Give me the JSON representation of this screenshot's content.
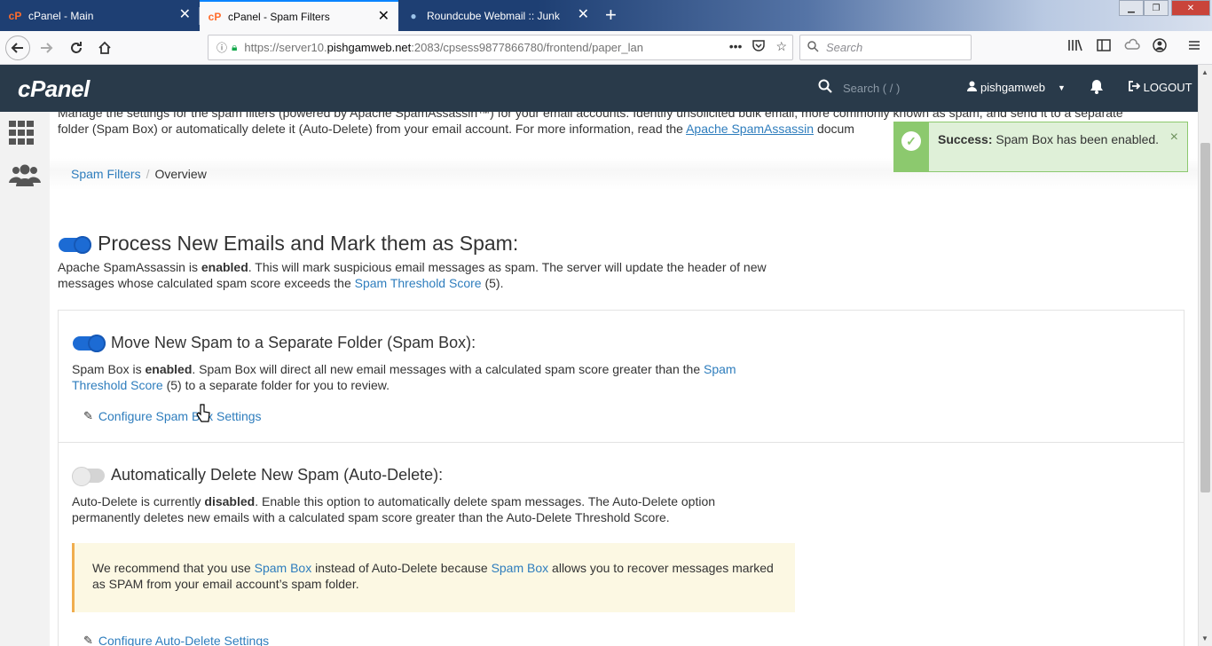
{
  "browser": {
    "tabs": [
      {
        "title": "cPanel - Main",
        "icon": "cpanel-icon"
      },
      {
        "title": "cPanel - Spam Filters",
        "icon": "cpanel-icon"
      },
      {
        "title": "Roundcube Webmail :: Junk",
        "icon": "roundcube-icon"
      }
    ],
    "new_tab": "+",
    "url_prefix": "https://server10.",
    "url_host": "pishgamweb.net",
    "url_rest": ":2083/cpsess9877866780/frontend/paper_lan",
    "search_placeholder": "Search"
  },
  "header": {
    "logo": "cPanel",
    "search_placeholder": "Search ( / )",
    "username": "pishgamweb",
    "logout": "LOGOUT",
    "colors": {
      "header_bg": "#293a4a",
      "accent": "#1c6bd4"
    }
  },
  "intro": {
    "line1": "Manage the settings for the spam filters (powered by Apache SpamAssassin™) for your email accounts. Identify unsolicited bulk email, more commonly known as spam, and send it to a separate",
    "line2_prefix": "folder (Spam Box) or automatically delete it (Auto-Delete) from your email account. For more information, read the ",
    "line2_link": "Apache SpamAssassin",
    "line2_suffix": " docum"
  },
  "breadcrumb": {
    "parent": "Spam Filters",
    "separator": "/",
    "current": "Overview"
  },
  "process": {
    "title": "Process New Emails and Mark them as Spam:",
    "enabled": true,
    "text_a": "Apache SpamAssassin is ",
    "text_bold": "enabled",
    "text_b": ". This will mark suspicious email messages as spam. The server will update the header of new messages whose calculated spam score exceeds the ",
    "link": "Spam Threshold Score",
    "text_c": " (5)."
  },
  "spambox": {
    "title": "Move New Spam to a Separate Folder (Spam Box):",
    "enabled": true,
    "text_a": "Spam Box is ",
    "text_bold": "enabled",
    "text_b": ". Spam Box will direct all new email messages with a calculated spam score greater than the ",
    "link": "Spam Threshold Score",
    "text_c": " (5) to a separate folder for you to review.",
    "configure": "Configure Spam Box Settings"
  },
  "autodelete": {
    "title": "Automatically Delete New Spam (Auto-Delete):",
    "enabled": false,
    "text_a": "Auto-Delete is currently ",
    "text_bold": "disabled",
    "text_b": ". Enable this option to automatically delete spam messages. The Auto-Delete option permanently deletes new emails with a calculated spam score greater than the Auto-Delete Threshold Score.",
    "warn_a": "We recommend that you use ",
    "warn_link1": "Spam Box",
    "warn_b": " instead of Auto-Delete because ",
    "warn_link2": "Spam Box",
    "warn_c": " allows you to recover messages marked as SPAM from your email account’s spam folder.",
    "configure": "Configure Auto-Delete Settings"
  },
  "toast": {
    "label": "Success:",
    "message": " Spam Box has been enabled.",
    "close": "×"
  }
}
